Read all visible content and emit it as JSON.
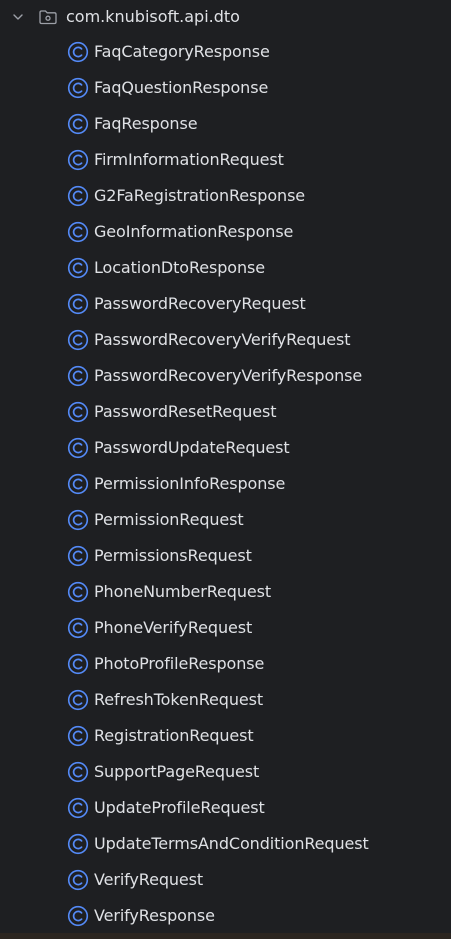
{
  "package": {
    "label": "com.knubisoft.api.dto",
    "expanded": true,
    "icon": "package-folder-icon"
  },
  "classes": [
    {
      "label": "FaqCategoryResponse"
    },
    {
      "label": "FaqQuestionResponse"
    },
    {
      "label": "FaqResponse"
    },
    {
      "label": "FirmInformationRequest"
    },
    {
      "label": "G2FaRegistrationResponse"
    },
    {
      "label": "GeoInformationResponse"
    },
    {
      "label": "LocationDtoResponse"
    },
    {
      "label": "PasswordRecoveryRequest"
    },
    {
      "label": "PasswordRecoveryVerifyRequest"
    },
    {
      "label": "PasswordRecoveryVerifyResponse"
    },
    {
      "label": "PasswordResetRequest"
    },
    {
      "label": "PasswordUpdateRequest"
    },
    {
      "label": "PermissionInfoResponse"
    },
    {
      "label": "PermissionRequest"
    },
    {
      "label": "PermissionsRequest"
    },
    {
      "label": "PhoneNumberRequest"
    },
    {
      "label": "PhoneVerifyRequest"
    },
    {
      "label": "PhotoProfileResponse"
    },
    {
      "label": "RefreshTokenRequest"
    },
    {
      "label": "RegistrationRequest"
    },
    {
      "label": "SupportPageRequest"
    },
    {
      "label": "UpdateProfileRequest"
    },
    {
      "label": "UpdateTermsAndConditionRequest"
    },
    {
      "label": "VerifyRequest"
    },
    {
      "label": "VerifyResponse"
    }
  ],
  "colors": {
    "background": "#1e1f22",
    "text": "#dfe1e5",
    "class_icon": "#548af7",
    "icon_gray": "#9da0a8"
  }
}
